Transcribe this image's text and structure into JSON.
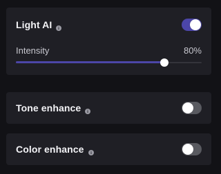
{
  "settings": {
    "light_ai": {
      "title": "Light AI",
      "info_icon": "info-icon",
      "enabled": true,
      "intensity": {
        "label": "Intensity",
        "value_text": "80%",
        "value": 0.8
      }
    },
    "tone_enhance": {
      "title": "Tone enhance",
      "info_icon": "info-icon",
      "enabled": false
    },
    "color_enhance": {
      "title": "Color enhance",
      "info_icon": "info-icon",
      "enabled": false
    }
  },
  "colors": {
    "background": "#121216",
    "panel": "#1f1f25",
    "accent": "#4c46a8",
    "toggle_off": "#595a60",
    "text": "#f3f3f6",
    "muted_text": "#c7c7cf"
  }
}
